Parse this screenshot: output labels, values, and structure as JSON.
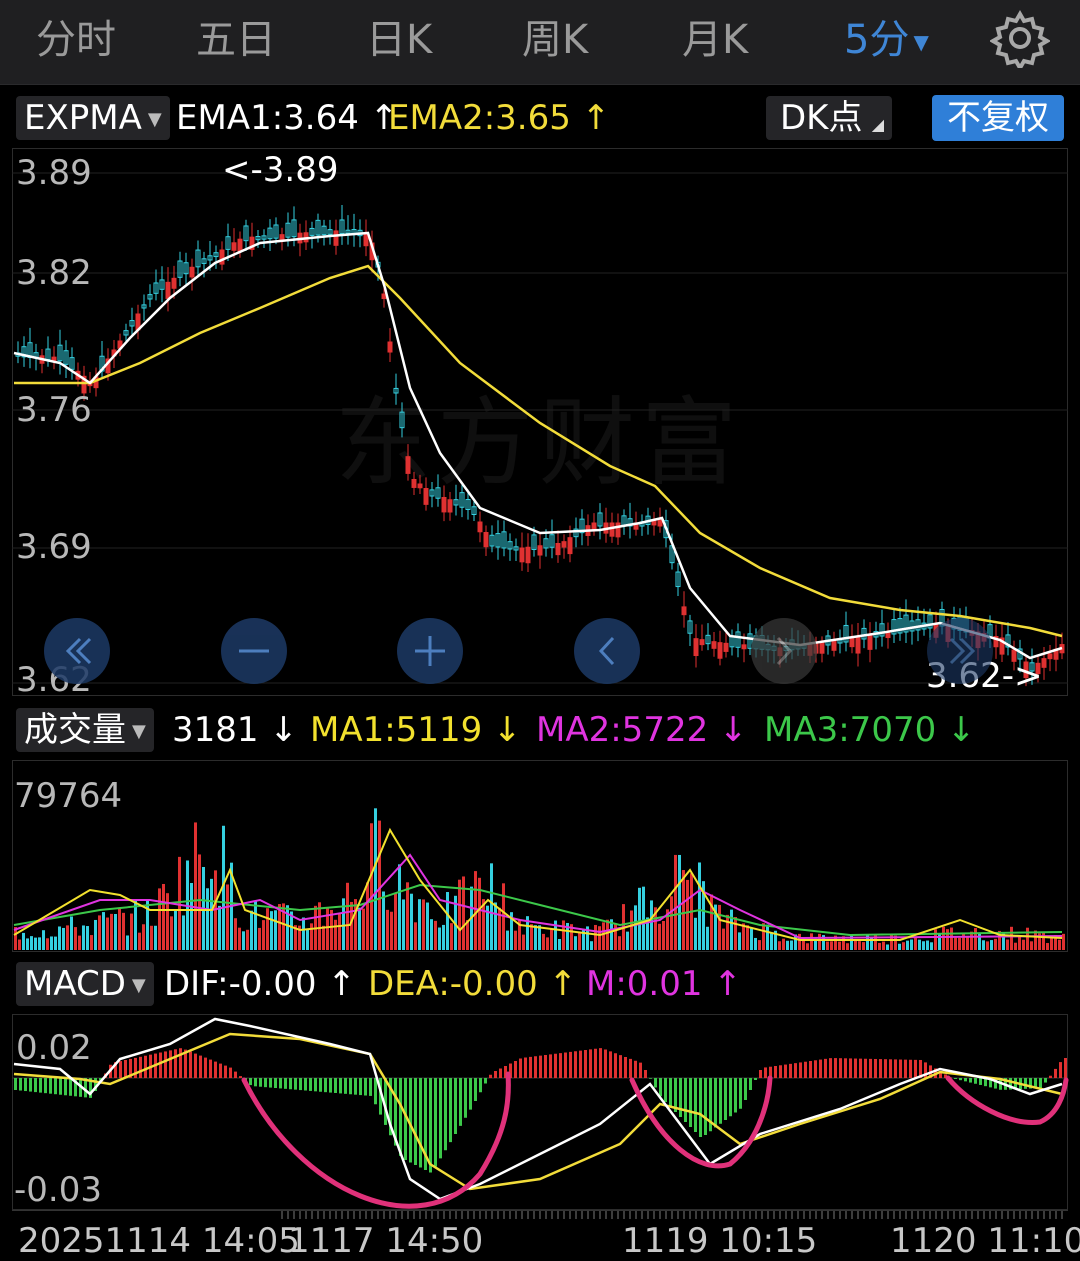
{
  "tabs": [
    {
      "label": "分时"
    },
    {
      "label": "五日"
    },
    {
      "label": "日K"
    },
    {
      "label": "周K"
    },
    {
      "label": "月K"
    },
    {
      "label": "5分"
    }
  ],
  "active_tab": "5分",
  "watermark": "东方财富",
  "main_chart": {
    "indicator": "EXPMA",
    "ema1": "EMA1:3.64",
    "ema1_arrow": "↑",
    "ema2": "EMA2:3.65",
    "ema2_arrow": "↑",
    "dk_label": "DK点",
    "fuquan_label": "不复权",
    "y_labels": [
      "3.89",
      "3.82",
      "3.76",
      "3.69",
      "3.62"
    ],
    "high_marker": "<-3.89",
    "low_marker": "3.62->"
  },
  "volume_chart": {
    "indicator": "成交量",
    "vol": "3181",
    "vol_arrow": "↓",
    "ma1": "MA1:5119",
    "ma1_arrow": "↓",
    "ma2": "MA2:5722",
    "ma2_arrow": "↓",
    "ma3": "MA3:7070",
    "ma3_arrow": "↓",
    "y_max": "79764"
  },
  "macd_chart": {
    "indicator": "MACD",
    "dif": "DIF:-0.00",
    "dif_arrow": "↑",
    "dea": "DEA:-0.00",
    "dea_arrow": "↑",
    "m": "M:0.01",
    "m_arrow": "↑",
    "y_labels": [
      "0.02",
      "-0.03"
    ]
  },
  "time_axis": [
    "20251114 14:05",
    "1117 14:50",
    "1119 10:15",
    "1120 11:10"
  ],
  "colors": {
    "up": "#e03131",
    "down": "#35d0e0",
    "ema1": "#ffffff",
    "ema2": "#f2dc3a",
    "ma1": "#f2e12e",
    "ma2": "#e034e0",
    "ma3": "#3cc84a",
    "accent": "#3f86d6",
    "annotation": "#e0317a"
  },
  "icons": [
    "settings-gear-icon",
    "zoom-out-double-chevron-icon",
    "minus-icon",
    "plus-icon",
    "chevron-left-icon",
    "chevron-right-icon",
    "chevron-right-double-icon"
  ]
}
